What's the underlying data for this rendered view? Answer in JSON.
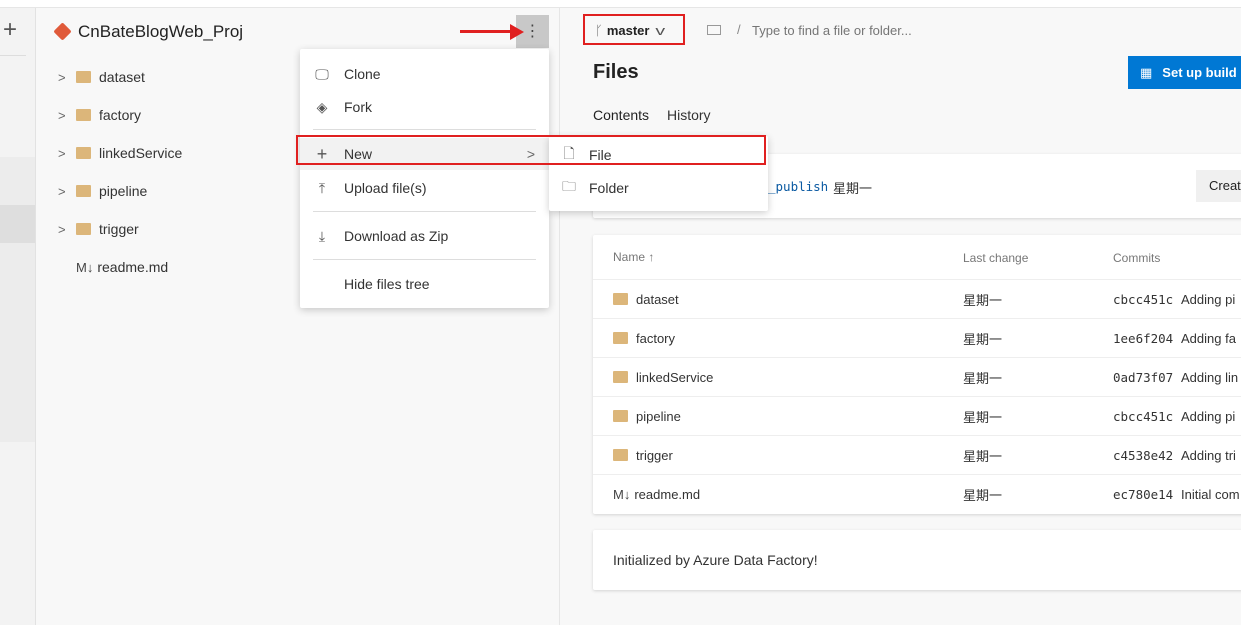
{
  "project": {
    "name": "CnBateBlogWeb_Proj"
  },
  "tree": [
    {
      "label": "dataset",
      "type": "folder"
    },
    {
      "label": "factory",
      "type": "folder"
    },
    {
      "label": "linkedService",
      "type": "folder"
    },
    {
      "label": "pipeline",
      "type": "folder"
    },
    {
      "label": "trigger",
      "type": "folder"
    },
    {
      "label": "readme.md",
      "type": "markdown",
      "prefix": "M↓"
    }
  ],
  "menu": {
    "clone": "Clone",
    "fork": "Fork",
    "new": "New",
    "upload": "Upload file(s)",
    "download": "Download as Zip",
    "hide": "Hide files tree"
  },
  "submenu": {
    "file": "File",
    "folder": "Folder"
  },
  "branch": "master",
  "path_placeholder": "Type to find a file or folder...",
  "path_sep": "/",
  "page_title": "Files",
  "setup_build": "Set up build",
  "tabs": {
    "contents": "Contents",
    "history": "History"
  },
  "banner": {
    "branch": "_publish",
    "date": "星期一",
    "create": "Create"
  },
  "table": {
    "headers": {
      "name": "Name",
      "sort": "↑",
      "last_change": "Last change",
      "commits": "Commits"
    },
    "rows": [
      {
        "name": "dataset",
        "type": "folder",
        "last": "星期一",
        "hash": "cbcc451c",
        "msg": "Adding pi"
      },
      {
        "name": "factory",
        "type": "folder",
        "last": "星期一",
        "hash": "1ee6f204",
        "msg": "Adding fa"
      },
      {
        "name": "linkedService",
        "type": "folder",
        "last": "星期一",
        "hash": "0ad73f07",
        "msg": "Adding lin"
      },
      {
        "name": "pipeline",
        "type": "folder",
        "last": "星期一",
        "hash": "cbcc451c",
        "msg": "Adding pi"
      },
      {
        "name": "trigger",
        "type": "folder",
        "last": "星期一",
        "hash": "c4538e42",
        "msg": "Adding tri"
      },
      {
        "name": "readme.md",
        "type": "markdown",
        "prefix": "M↓",
        "last": "星期一",
        "hash": "ec780e14",
        "msg": "Initial com"
      }
    ]
  },
  "readme": "Initialized by Azure Data Factory!",
  "colors": {
    "accent": "#0078d4",
    "folder": "#dcb67a",
    "annotation": "#e02020",
    "git": "#e05a3a"
  }
}
